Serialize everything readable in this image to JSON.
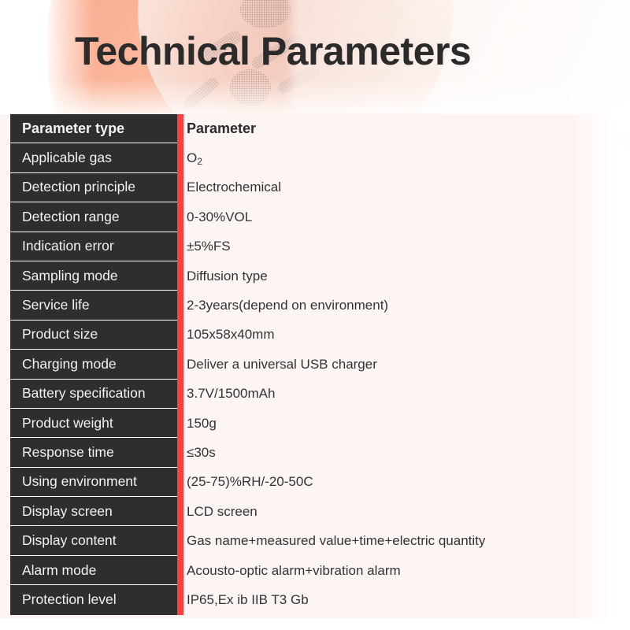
{
  "page": {
    "title": "Technical Parameters",
    "accent_color": "#fc4040",
    "header_cell_color": "#2e2e2e",
    "panel_background": "#fdf5f4",
    "value_text_color": "#333333"
  },
  "table": {
    "headers": {
      "type": "Parameter type",
      "value": "Parameter"
    },
    "rows": [
      {
        "type": "Applicable gas",
        "value": "O2",
        "value_html": "O<sub>2</sub>"
      },
      {
        "type": "Detection principle",
        "value": "Electrochemical"
      },
      {
        "type": "Detection range",
        "value": "0-30%VOL"
      },
      {
        "type": "Indication error",
        "value": "±5%FS"
      },
      {
        "type": "Sampling mode",
        "value": "Diffusion type"
      },
      {
        "type": "Service life",
        "value": "2-3years(depend on environment)"
      },
      {
        "type": "Product size",
        "value": "105x58x40mm"
      },
      {
        "type": "Charging mode",
        "value": "Deliver a universal USB charger"
      },
      {
        "type": "Battery specification",
        "value": "3.7V/1500mAh"
      },
      {
        "type": "Product weight",
        "value": "150g"
      },
      {
        "type": "Response time",
        "value": "≤30s"
      },
      {
        "type": "Using environment",
        "value": "(25-75)%RH/-20-50C"
      },
      {
        "type": "Display screen",
        "value": "LCD screen"
      },
      {
        "type": "Display content",
        "value": "Gas name+measured value+time+electric quantity"
      },
      {
        "type": "Alarm mode",
        "value": "Acousto-optic alarm+vibration alarm"
      },
      {
        "type": "Protection level",
        "value": "IP65,Ex ib IIB T3 Gb"
      }
    ]
  }
}
